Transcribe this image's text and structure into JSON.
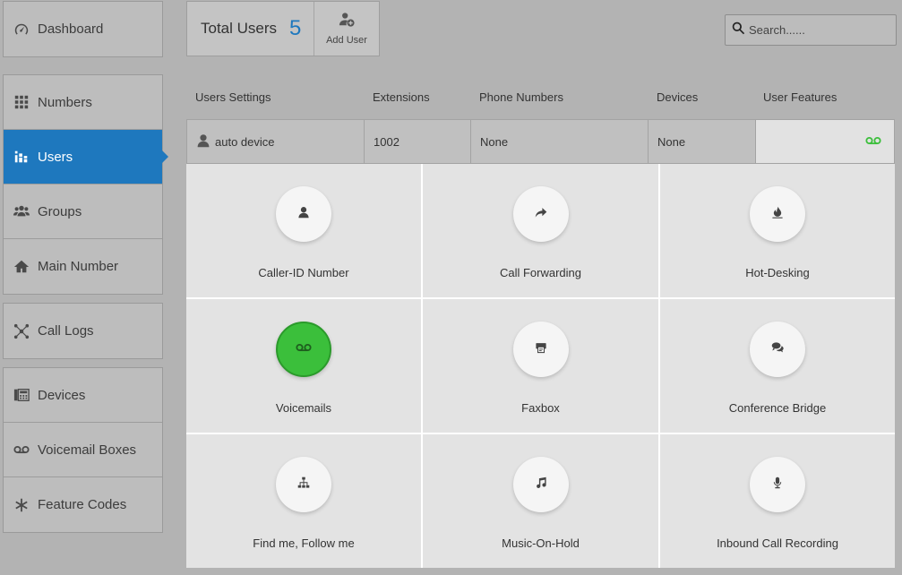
{
  "sidebar": {
    "groups": [
      [
        {
          "label": "Dashboard",
          "icon": "speedometer-icon"
        }
      ],
      [
        {
          "label": "Numbers",
          "icon": "grid-icon"
        },
        {
          "label": "Users",
          "icon": "users-icon",
          "active": true
        },
        {
          "label": "Groups",
          "icon": "group-icon"
        },
        {
          "label": "Main Number",
          "icon": "home-icon"
        }
      ],
      [
        {
          "label": "Call Logs",
          "icon": "network-icon"
        }
      ],
      [
        {
          "label": "Devices",
          "icon": "desk-phone-icon"
        },
        {
          "label": "Voicemail Boxes",
          "icon": "voicemail-icon"
        },
        {
          "label": "Feature Codes",
          "icon": "asterisk-icon"
        }
      ]
    ]
  },
  "header": {
    "total_label": "Total Users",
    "total_count": "5",
    "add_user_label": "Add User"
  },
  "search": {
    "placeholder": "Search......"
  },
  "columns": {
    "user_settings": "Users Settings",
    "extensions": "Extensions",
    "phone_numbers": "Phone Numbers",
    "devices": "Devices",
    "user_features": "User Features"
  },
  "user_row": {
    "name": "auto device",
    "extension": "1002",
    "phone_numbers": "None",
    "devices": "None"
  },
  "features": [
    {
      "label": "Caller-ID Number",
      "icon": "person-icon",
      "enabled": false
    },
    {
      "label": "Call Forwarding",
      "icon": "forward-arrow-icon",
      "enabled": false
    },
    {
      "label": "Hot-Desking",
      "icon": "fire-icon",
      "enabled": false
    },
    {
      "label": "Voicemails",
      "icon": "voicemail-icon",
      "enabled": true
    },
    {
      "label": "Faxbox",
      "icon": "fax-icon",
      "enabled": false
    },
    {
      "label": "Conference Bridge",
      "icon": "chat-bubbles-icon",
      "enabled": false
    },
    {
      "label": "Find me, Follow me",
      "icon": "sitemap-icon",
      "enabled": false
    },
    {
      "label": "Music-On-Hold",
      "icon": "music-note-icon",
      "enabled": false
    },
    {
      "label": "Inbound Call Recording",
      "icon": "microphone-icon",
      "enabled": false
    }
  ],
  "colors": {
    "accent": "#1e78be",
    "enabled_green": "#3bbf3b",
    "background": "#b3b3b3"
  }
}
